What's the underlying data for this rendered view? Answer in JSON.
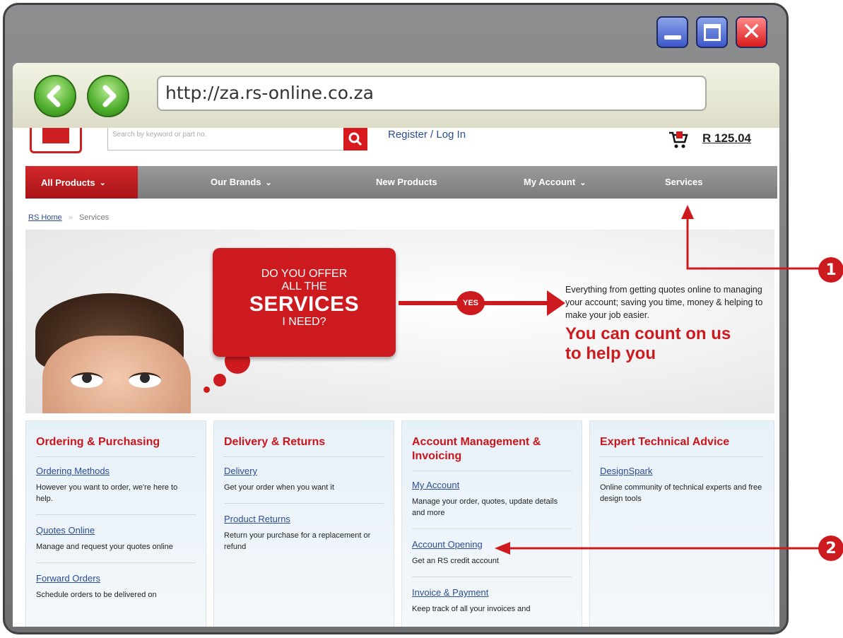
{
  "browser": {
    "url": "http://za.rs-online.co.za",
    "window_buttons": {
      "minimize_icon": "minimize-icon",
      "maximize_icon": "maximize-icon",
      "close_icon": "close-icon"
    },
    "nav_icons": {
      "back": "back-arrow-icon",
      "forward": "forward-arrow-icon"
    }
  },
  "site": {
    "search_placeholder": "Search by keyword or part no.",
    "register_label": "Register / Log In",
    "cart_total": "R 125.04",
    "menu": {
      "all_products": "All Products",
      "our_brands": "Our Brands",
      "new_products": "New Products",
      "my_account": "My Account",
      "services": "Services"
    },
    "breadcrumb": {
      "home": "RS Home",
      "separator": "»",
      "current": "Services"
    },
    "banner": {
      "bubble_line1": "DO YOU OFFER",
      "bubble_line2": "ALL THE",
      "bubble_line3": "SERVICES",
      "bubble_line4": "I NEED?",
      "yes": "YES",
      "text": "Everything from getting quotes online to managing your account; saving you time, money & helping to make your job easier.",
      "headline_1": "You can count on us",
      "headline_2": "to help you"
    },
    "columns": [
      {
        "title": "Ordering & Purchasing",
        "items": [
          {
            "link": "Ordering Methods",
            "desc": "However you want to order, we're here to help."
          },
          {
            "link": "Quotes Online",
            "desc": "Manage and request your quotes online"
          },
          {
            "link": "Forward Orders",
            "desc": "Schedule orders to be delivered on"
          }
        ]
      },
      {
        "title": "Delivery & Returns",
        "items": [
          {
            "link": "Delivery",
            "desc": "Get your order when you want it"
          },
          {
            "link": "Product Returns",
            "desc": "Return your purchase for a replacement or refund"
          }
        ]
      },
      {
        "title": "Account Management & Invoicing",
        "items": [
          {
            "link": "My Account",
            "desc": "Manage your order, quotes, update details and more"
          },
          {
            "link": "Account Opening",
            "desc": "Get an RS credit account"
          },
          {
            "link": "Invoice & Payment",
            "desc": "Keep track of all your invoices and"
          }
        ]
      },
      {
        "title": "Expert Technical Advice",
        "items": [
          {
            "link": "DesignSpark",
            "desc": "Online community of technical experts and free design tools"
          }
        ]
      }
    ]
  },
  "callouts": {
    "one": "1",
    "two": "2"
  },
  "colors": {
    "brand_red": "#cd1a1f",
    "menu_grey": "#8a8a8a",
    "link_blue": "#2b4d93",
    "window_blue": "#3c58c7",
    "nav_green": "#4fae2d"
  }
}
